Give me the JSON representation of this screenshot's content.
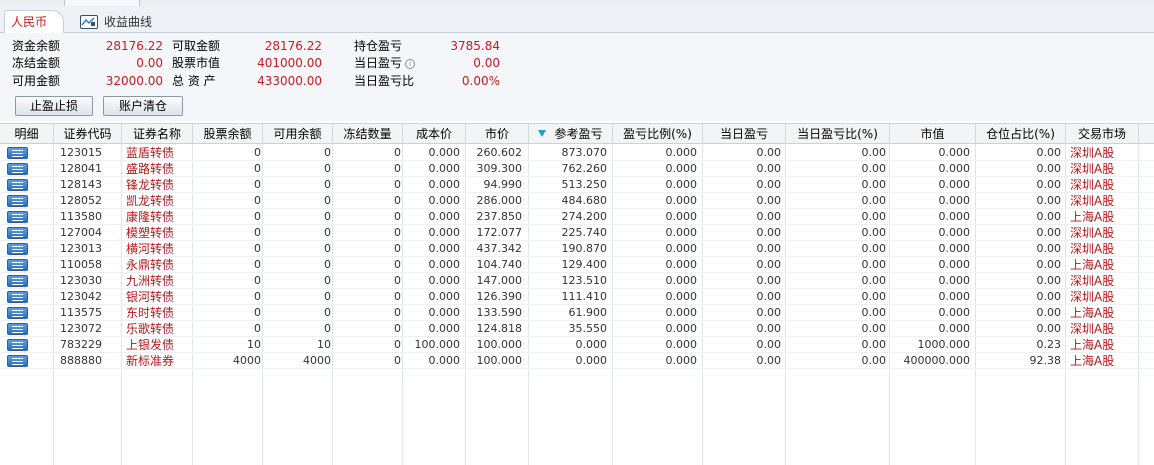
{
  "tabs": {
    "active": "人民币",
    "chart_tab": "收益曲线"
  },
  "summary": {
    "col1": [
      {
        "label": "资金余额",
        "value": "28176.22"
      },
      {
        "label": "冻结金额",
        "value": "0.00"
      },
      {
        "label": "可用金额",
        "value": "32000.00"
      }
    ],
    "col2": [
      {
        "label": "可取金额",
        "value": "28176.22"
      },
      {
        "label": "股票市值",
        "value": "401000.00"
      },
      {
        "label": "总 资 产",
        "value": "433000.00"
      }
    ],
    "col3": [
      {
        "label": "持仓盈亏",
        "value": "3785.84"
      },
      {
        "label": "当日盈亏",
        "value": "0.00"
      },
      {
        "label": "当日盈亏比",
        "value": "0.00%"
      }
    ],
    "info_glyph": "i"
  },
  "buttons": {
    "stop": "止盈止损",
    "clear": "账户清仓"
  },
  "table": {
    "headers": [
      "明细",
      "证券代码",
      "证券名称",
      "股票余额",
      "可用余额",
      "冻结数量",
      "成本价",
      "市价",
      "参考盈亏",
      "盈亏比例(%)",
      "当日盈亏",
      "当日盈亏比(%)",
      "市值",
      "仓位占比(%)",
      "交易市场"
    ],
    "rows": [
      [
        "123015",
        "蓝盾转债",
        "0",
        "0",
        "0",
        "0.000",
        "260.602",
        "873.070",
        "0.000",
        "0.00",
        "0.00",
        "0.000",
        "0.00",
        "深圳A股"
      ],
      [
        "128041",
        "盛路转债",
        "0",
        "0",
        "0",
        "0.000",
        "309.300",
        "762.260",
        "0.000",
        "0.00",
        "0.00",
        "0.000",
        "0.00",
        "深圳A股"
      ],
      [
        "128143",
        "锋龙转债",
        "0",
        "0",
        "0",
        "0.000",
        "94.990",
        "513.250",
        "0.000",
        "0.00",
        "0.00",
        "0.000",
        "0.00",
        "深圳A股"
      ],
      [
        "128052",
        "凯龙转债",
        "0",
        "0",
        "0",
        "0.000",
        "286.000",
        "484.680",
        "0.000",
        "0.00",
        "0.00",
        "0.000",
        "0.00",
        "深圳A股"
      ],
      [
        "113580",
        "康隆转债",
        "0",
        "0",
        "0",
        "0.000",
        "237.850",
        "274.200",
        "0.000",
        "0.00",
        "0.00",
        "0.000",
        "0.00",
        "上海A股"
      ],
      [
        "127004",
        "模塑转债",
        "0",
        "0",
        "0",
        "0.000",
        "172.077",
        "225.740",
        "0.000",
        "0.00",
        "0.00",
        "0.000",
        "0.00",
        "深圳A股"
      ],
      [
        "123013",
        "横河转债",
        "0",
        "0",
        "0",
        "0.000",
        "437.342",
        "190.870",
        "0.000",
        "0.00",
        "0.00",
        "0.000",
        "0.00",
        "深圳A股"
      ],
      [
        "110058",
        "永鼎转债",
        "0",
        "0",
        "0",
        "0.000",
        "104.740",
        "129.400",
        "0.000",
        "0.00",
        "0.00",
        "0.000",
        "0.00",
        "上海A股"
      ],
      [
        "123030",
        "九洲转债",
        "0",
        "0",
        "0",
        "0.000",
        "147.000",
        "123.510",
        "0.000",
        "0.00",
        "0.00",
        "0.000",
        "0.00",
        "深圳A股"
      ],
      [
        "123042",
        "银河转债",
        "0",
        "0",
        "0",
        "0.000",
        "126.390",
        "111.410",
        "0.000",
        "0.00",
        "0.00",
        "0.000",
        "0.00",
        "深圳A股"
      ],
      [
        "113575",
        "东时转债",
        "0",
        "0",
        "0",
        "0.000",
        "133.590",
        "61.900",
        "0.000",
        "0.00",
        "0.00",
        "0.000",
        "0.00",
        "上海A股"
      ],
      [
        "123072",
        "乐歌转债",
        "0",
        "0",
        "0",
        "0.000",
        "124.818",
        "35.550",
        "0.000",
        "0.00",
        "0.00",
        "0.000",
        "0.00",
        "深圳A股"
      ],
      [
        "783229",
        "上银发债",
        "10",
        "10",
        "0",
        "100.000",
        "100.000",
        "0.000",
        "0.000",
        "0.00",
        "0.00",
        "1000.000",
        "0.23",
        "上海A股"
      ],
      [
        "888880",
        "新标准券",
        "4000",
        "4000",
        "0",
        "0.000",
        "100.000",
        "0.000",
        "0.000",
        "0.00",
        "0.00",
        "400000.000",
        "92.38",
        "上海A股"
      ]
    ]
  },
  "colors": {
    "value_red": "#c81c1c",
    "name_red": "#b5191a",
    "sort_indicator": "#18a4c7",
    "detail_icon_blue": "#2e6fc0"
  },
  "icons": {
    "chart_tab": "line-chart-icon",
    "detail": "list-detail-icon",
    "sort": "sort-desc-triangle-icon",
    "info": "info-icon"
  }
}
